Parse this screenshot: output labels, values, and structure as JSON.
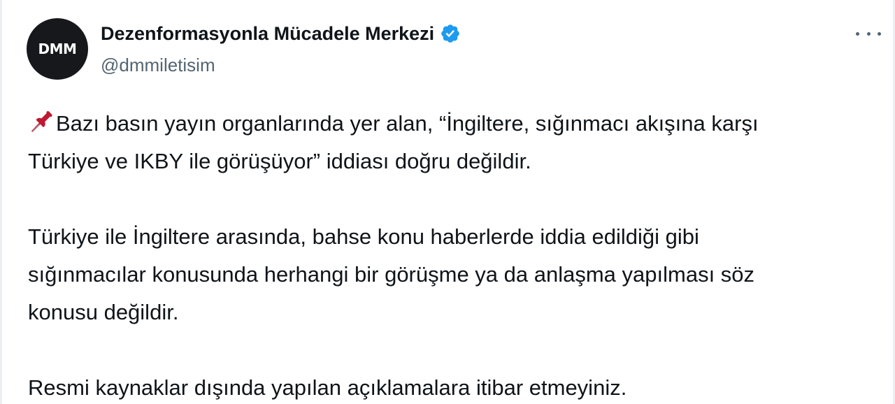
{
  "tweet": {
    "author": {
      "avatar_text": "DMM",
      "display_name": "Dezenformasyonla Mücadele Merkezi",
      "handle": "@dmmiletisim",
      "verified_icon": "verified-badge-icon",
      "verified_color": "#1d9bf0"
    },
    "more_icon": "more-horizontal-icon",
    "paragraphs": [
      {
        "icon": "pushpin-icon",
        "line1": "Bazı basın yayın organlarında yer alan, “İngiltere, sığınmacı akışına karşı",
        "line2": "Türkiye ve IKBY ile görüşüyor” iddiası doğru değildir."
      },
      {
        "line1": "Türkiye ile İngiltere arasında, bahse konu haberlerde iddia edildiği gibi",
        "line2": "sığınmacılar konusunda herhangi bir görüşme ya da anlaşma yapılması söz",
        "line3": "konusu değildir."
      },
      {
        "line1": "Resmi kaynaklar dışında yapılan açıklamalara itibar etmeyiniz."
      }
    ],
    "colors": {
      "text": "#0f1419",
      "secondary": "#536471",
      "avatar_bg": "#16181c",
      "pin": "#e0245e"
    }
  }
}
